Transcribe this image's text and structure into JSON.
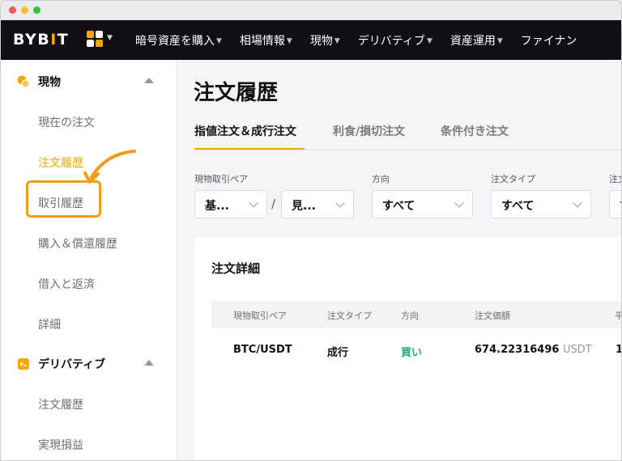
{
  "nav": {
    "logo_left": "BYB",
    "logo_bar": "I",
    "logo_right": "T",
    "items": [
      "暗号資産を購入",
      "相場情報",
      "現物",
      "デリバティブ",
      "資産運用",
      "ファイナン"
    ]
  },
  "sidebar": {
    "spot": {
      "label": "現物",
      "items": [
        "現在の注文",
        "注文履歴",
        "取引履歴",
        "購入＆償還履歴",
        "借入と返済",
        "詳細"
      ]
    },
    "derivatives": {
      "label": "デリバティブ",
      "items": [
        "注文履歴",
        "実現損益"
      ]
    }
  },
  "main": {
    "title": "注文履歴",
    "tabs": [
      "指値注文＆成行注文",
      "利食/損切注文",
      "条件付き注文"
    ],
    "filters": {
      "pair_label": "現物取引ペア",
      "pair_base": "基...",
      "pair_quote": "見...",
      "side_label": "方向",
      "side_value": "すべて",
      "type_label": "注文タイプ",
      "type_value": "すべて",
      "extra_label": "注文",
      "extra_value": "す"
    },
    "card": {
      "title": "注文詳細",
      "columns": [
        "現物取引ペア",
        "注文タイプ",
        "方向",
        "注文価額",
        "平"
      ],
      "rows": [
        {
          "pair": "BTC/USDT",
          "type": "成行",
          "side": "買い",
          "value": "674.22316496",
          "unit": "USDT",
          "extra": "1"
        }
      ]
    }
  },
  "colors": {
    "accent": "#f7a600",
    "buy": "#20b26c",
    "highlight": "#f39c19"
  }
}
